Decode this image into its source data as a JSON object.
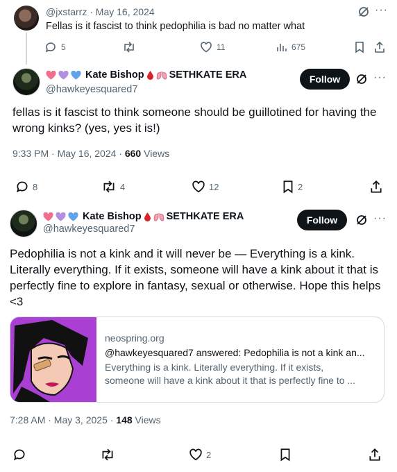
{
  "tweet_a": {
    "handle": "@jxstarrz",
    "separator": "·",
    "date": "May 16, 2024",
    "text": "Fellas is it fascist to think pedophilia is bad no matter what",
    "replies": "5",
    "retweets": "",
    "likes": "11",
    "views": "675"
  },
  "tweet_b": {
    "display_name": "Kate Bishop",
    "name_suffix": "SETHKATE ERA",
    "handle": "@hawkeyesquared7",
    "follow_label": "Follow",
    "text": "fellas is it fascist to think someone should be guillotined for having the wrong kinks? (yes, yes it is!)",
    "time": "9:33 PM · May 16, 2024 · ",
    "views_count": "660",
    "views_label": " Views",
    "replies": "8",
    "retweets": "4",
    "likes": "12",
    "bookmarks": "2"
  },
  "tweet_c": {
    "display_name": "Kate Bishop",
    "name_suffix": "SETHKATE ERA",
    "handle": "@hawkeyesquared7",
    "follow_label": "Follow",
    "text_lines": [
      "Pedophilia is not a kink and it will never be — Everything is a kink.",
      "Literally everything. If it exists, someone will have a kink about it that is",
      "perfectly fine to explore in fantasy, sexual or otherwise. Hope this helps",
      "<3"
    ],
    "card": {
      "domain": "neospring.org",
      "title": "@hawkeyesquared7 answered: Pedophilia is not a kink an...",
      "desc_lines": [
        "Everything is a kink. Literally everything. If it exists,",
        "someone will have a kink about it that is perfectly fine to ..."
      ]
    },
    "time": "7:28 AM · May 3, 2025 · ",
    "views_count": "148",
    "views_label": " Views",
    "replies": "",
    "retweets": "",
    "likes": "2",
    "bookmarks": ""
  },
  "colors": {
    "text": "#0f1419",
    "secondary": "#536471",
    "border": "#cfd9de",
    "follow_bg": "#0f1419",
    "heart_pink": "#f06f8d",
    "heart_purple": "#b48fe0",
    "heart_blue": "#5fa3e8",
    "blood_red": "#d8232a",
    "card_purple": "#a93fd3"
  },
  "icons": {
    "reply": "reply-icon",
    "retweet": "retweet-icon",
    "like": "heart-icon",
    "views": "views-icon",
    "bookmark": "bookmark-icon",
    "share": "share-icon",
    "grok": "grok-icon",
    "more": "more-icon"
  },
  "more_glyph": "···"
}
